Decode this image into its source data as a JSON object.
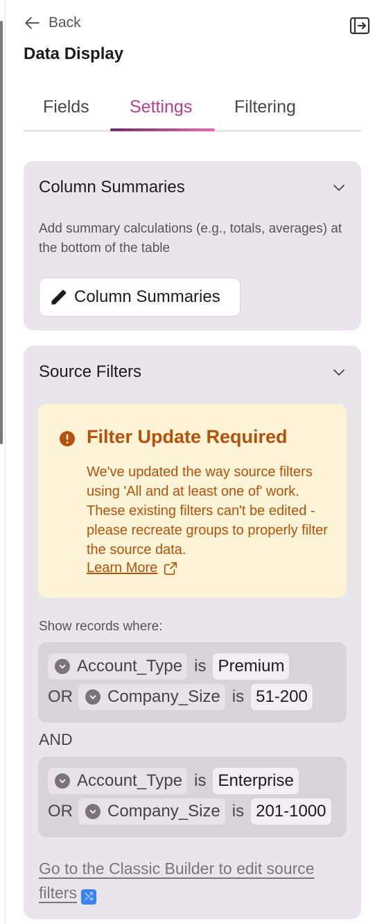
{
  "header": {
    "back_label": "Back",
    "title": "Data Display"
  },
  "tabs": [
    {
      "label": "Fields",
      "active": false
    },
    {
      "label": "Settings",
      "active": true
    },
    {
      "label": "Filtering",
      "active": false
    }
  ],
  "column_summaries": {
    "title": "Column Summaries",
    "description": "Add summary calculations (e.g., totals, averages) at the bottom of the table",
    "button_label": "Column Summaries"
  },
  "source_filters": {
    "title": "Source Filters",
    "alert": {
      "title": "Filter Update Required",
      "body": "We've updated the way source filters using 'All and at least one of' work. These existing filters can't be edited - please recreate groups to properly filter the source data.",
      "link": "Learn More"
    },
    "show_label": "Show records where:",
    "operator_join": "AND",
    "groups": [
      {
        "rows": [
          {
            "connector": "",
            "field": "Account_Type",
            "op": "is",
            "value": "Premium"
          },
          {
            "connector": "OR",
            "field": "Company_Size",
            "op": "is",
            "value": "51-200"
          }
        ]
      },
      {
        "rows": [
          {
            "connector": "",
            "field": "Account_Type",
            "op": "is",
            "value": "Enterprise"
          },
          {
            "connector": "OR",
            "field": "Company_Size",
            "op": "is",
            "value": "201-1000"
          }
        ]
      }
    ],
    "classic_link": "Go to the Classic Builder to edit source filters"
  },
  "colors": {
    "accent": "#b43f8e",
    "alert_text": "#b4510a",
    "alert_bg": "#fdf3d7",
    "card_bg": "#e8e6e9"
  }
}
